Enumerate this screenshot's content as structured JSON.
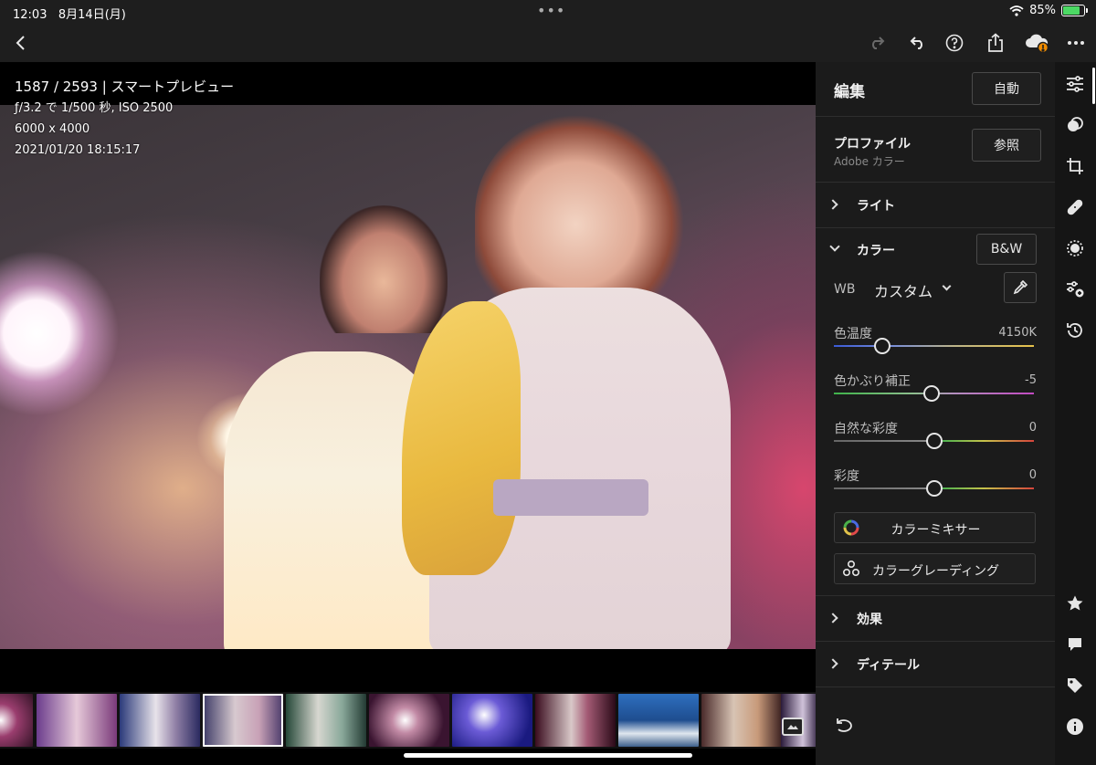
{
  "status": {
    "time": "12:03",
    "date": "8月14日(月)",
    "battery": "85%",
    "battery_level": 0.85
  },
  "topbar": {
    "back_icon": "chevron-left-icon",
    "redo_icon": "redo-icon",
    "undo_icon": "undo-icon",
    "help_icon": "help-icon",
    "share_icon": "share-icon",
    "cloud_icon": "cloud-warning-icon",
    "more_icon": "more-icon"
  },
  "photo_info": {
    "line1": "1587 / 2593 | スマートプレビュー",
    "line2": "ƒ/3.2 で 1/500 秒, ISO 2500",
    "line3": "6000 x 4000",
    "line4": "2021/01/20 18:15:17"
  },
  "panel": {
    "title": "編集",
    "auto_label": "自動",
    "profile": {
      "title": "プロファイル",
      "value": "Adobe カラー",
      "browse_label": "参照"
    },
    "light_label": "ライト",
    "color": {
      "title": "カラー",
      "bw_label": "B&W",
      "wb_label": "WB",
      "wb_value": "カスタム",
      "sliders": [
        {
          "label": "色温度",
          "value": "4150K",
          "position": 0.24
        },
        {
          "label": "色かぶり補正",
          "value": "-5",
          "position": 0.49
        },
        {
          "label": "自然な彩度",
          "value": "0",
          "position": 0.5
        },
        {
          "label": "彩度",
          "value": "0",
          "position": 0.5
        }
      ],
      "mixer_label": "カラーミキサー",
      "grading_label": "カラーグレーディング"
    },
    "effects_label": "効果",
    "detail_label": "ディテール"
  },
  "colors": {
    "accent": "#ffffff",
    "panel_bg": "#1b1b1b",
    "cloud_badge": "#f08c00",
    "battery_fill": "#4cd964"
  }
}
